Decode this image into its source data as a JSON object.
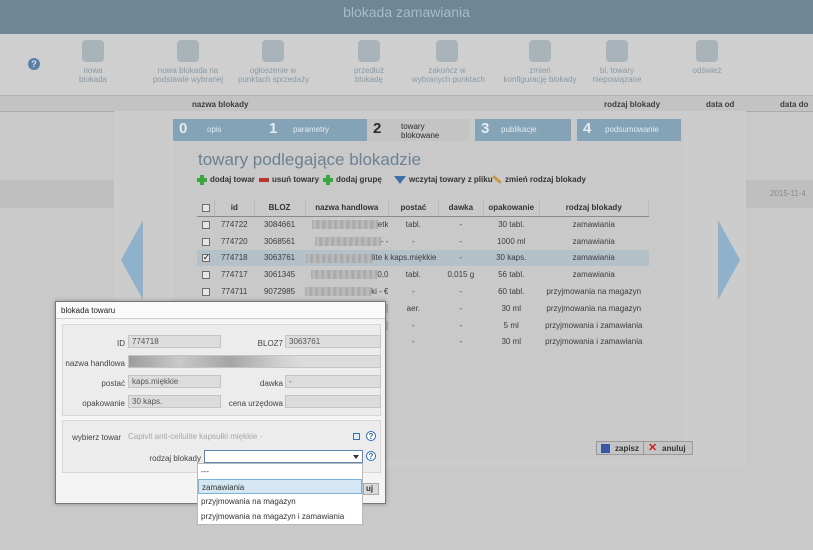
{
  "app": {
    "title": "blokada zamawiania",
    "toolbar": [
      {
        "label": "nowa\nblokada",
        "icon": "new-block-icon"
      },
      {
        "label": "nowa blokada na\npodstawie wybranej",
        "icon": "copy-block-icon"
      },
      {
        "label": "ogłoszenie w\npunktach sprzedaży",
        "icon": "announce-icon"
      },
      {
        "label": "przedłuż\nblokadę",
        "icon": "extend-icon"
      },
      {
        "label": "zakończ w\nwybranych punktach",
        "icon": "finish-icon"
      },
      {
        "label": "zmień\nkonfigurację blokady",
        "icon": "config-icon"
      },
      {
        "label": "bl. towary\nniepowiązane",
        "icon": "unlinked-icon"
      },
      {
        "label": "odśwież",
        "icon": "refresh-icon"
      }
    ],
    "columns": [
      "nazwa blokady",
      "rodzaj blokady",
      "data od",
      "data do"
    ],
    "row_date": "2015-11-4"
  },
  "wizard": {
    "steps": [
      {
        "num": "0",
        "label": "opis"
      },
      {
        "num": "1",
        "label": "parametry"
      },
      {
        "num": "2",
        "label": "towary\nblokowane"
      },
      {
        "num": "3",
        "label": "publikacje"
      },
      {
        "num": "4",
        "label": "podsumowanie"
      }
    ],
    "title": "towary podlegające blokadzie",
    "actions": {
      "add": "dodaj towar",
      "remove": "usuń towary",
      "add_group": "dodaj grupę",
      "load": "wczytaj towary z pliku",
      "change_type": "zmień rodzaj blokady"
    },
    "table": {
      "headers": [
        "",
        "id",
        "BLOZ",
        "nazwa handlowa",
        "postać",
        "dawka",
        "opakowanie",
        "rodzaj blokady"
      ],
      "rows": [
        {
          "id": "774722",
          "bloz": "3084661",
          "name_tail": "etk",
          "postac": "tabl.",
          "dawka": "-",
          "opak": "30 tabl.",
          "rodzaj": "zamawiania",
          "checked": false
        },
        {
          "id": "774720",
          "bloz": "3068561",
          "name_tail": "- -",
          "postac": "-",
          "dawka": "-",
          "opak": "1000 ml",
          "rodzaj": "zamawiania",
          "checked": false
        },
        {
          "id": "774718",
          "bloz": "3063761",
          "name_tail": "lite k",
          "postac": "kaps.miękkie",
          "dawka": "-",
          "opak": "30 kaps.",
          "rodzaj": "zamawiania",
          "checked": true
        },
        {
          "id": "774717",
          "bloz": "3061345",
          "name_tail": "0,0",
          "postac": "tabl.",
          "dawka": "0,015 g",
          "opak": "56 tabl.",
          "rodzaj": "zamawiania",
          "checked": false
        },
        {
          "id": "774711",
          "bloz": "9072985",
          "name_tail": "ki - €",
          "postac": "-",
          "dawka": "-",
          "opak": "60 tabl.",
          "rodzaj": "przyjmowania na magazyn",
          "checked": false
        },
        {
          "id": "",
          "bloz": "",
          "name_tail": "",
          "postac": "aer.",
          "dawka": "-",
          "opak": "30 ml",
          "rodzaj": "przyjmowania na magazyn",
          "checked": false
        },
        {
          "id": "",
          "bloz": "",
          "name_tail": "",
          "postac": "-",
          "dawka": "-",
          "opak": "5 ml",
          "rodzaj": "przyjmowania i zamawiania",
          "checked": false
        },
        {
          "id": "",
          "bloz": "",
          "name_tail": "",
          "postac": "-",
          "dawka": "-",
          "opak": "30 ml",
          "rodzaj": "przyjmowania i zamawiania",
          "checked": false
        }
      ]
    },
    "save": "zapisz",
    "cancel": "anuluj"
  },
  "dialog": {
    "title": "blokada towaru",
    "id_label": "ID",
    "id_value": "774718",
    "bloz_label": "BLOZ7",
    "bloz_value": "3063761",
    "name_label": "nazwa handlowa",
    "form_label": "postać",
    "form_value": "kaps.miękkie",
    "dose_label": "dawka",
    "dose_value": "-",
    "pack_label": "opakowanie",
    "pack_value": "30 kaps.",
    "price_label": "cena urzędowa",
    "choose_label": "wybierz towar",
    "choose_placeholder": "Capivit anti-cellulite kapsułki miękkie -",
    "type_label": "rodzaj blokady",
    "ok_tail": "uj",
    "options": [
      "---",
      "zamawiania",
      "przyjmowania na magazyn",
      "przyjmowania na magazyn i zamawiania"
    ]
  }
}
